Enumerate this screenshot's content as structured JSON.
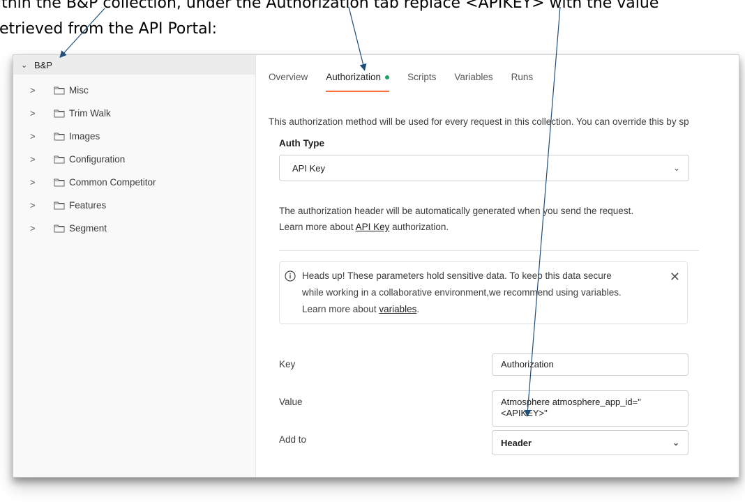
{
  "caption": {
    "line1": "ithin the B&P collection, under the Authorization tab replace <APIKEY> with the value",
    "line2": "etrieved from the API Portal:"
  },
  "sidebar": {
    "root_label": "B&P",
    "items": [
      {
        "label": "Misc"
      },
      {
        "label": "Trim Walk"
      },
      {
        "label": "Images"
      },
      {
        "label": "Configuration"
      },
      {
        "label": "Common Competitor"
      },
      {
        "label": "Features"
      },
      {
        "label": "Segment"
      }
    ]
  },
  "tabs": [
    {
      "label": "Overview"
    },
    {
      "label": "Authorization",
      "active": true,
      "status_dot": "#1aa260"
    },
    {
      "label": "Scripts"
    },
    {
      "label": "Variables"
    },
    {
      "label": "Runs"
    }
  ],
  "auth": {
    "description": "This authorization method will be used for every request in this collection. You can override this by sp",
    "auth_type_label": "Auth Type",
    "auth_type_value": "API Key",
    "info_line1": "The authorization header will be automatically generated when you send the request.",
    "info_line2_prefix": "Learn more about ",
    "info_line2_link": "API Key",
    "info_line2_suffix": " authorization."
  },
  "callout": {
    "line1": "Heads up! These parameters hold sensitive data. To keep this data secure",
    "line2": "while working in a collaborative environment,we recommend using variables.",
    "line3_prefix": "Learn more about ",
    "line3_link": "variables",
    "line3_suffix": "."
  },
  "fields": {
    "key_label": "Key",
    "key_value": "Authorization",
    "value_label": "Value",
    "value_line1": "Atmosphere atmosphere_app_id=\"",
    "value_line2": "<APIKEY>\"",
    "addto_label": "Add to",
    "addto_value": "Header"
  },
  "colors": {
    "accent": "#ff6c37",
    "arrow": "#1f4e79"
  }
}
